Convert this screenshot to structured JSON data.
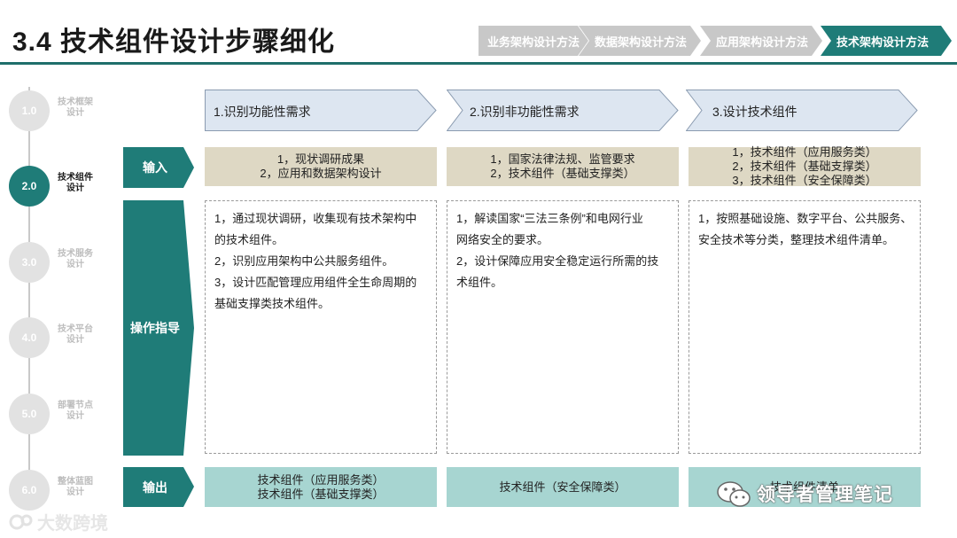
{
  "title": "3.4 技术组件设计步骤细化",
  "nav": [
    {
      "label": "业务架构设计方法",
      "active": false
    },
    {
      "label": "数据架构设计方法",
      "active": false
    },
    {
      "label": "应用架构设计方法",
      "active": false
    },
    {
      "label": "技术架构设计方法",
      "active": true
    }
  ],
  "timeline": [
    {
      "num": "1.0",
      "line1": "技术框架",
      "line2": "设计",
      "active": false
    },
    {
      "num": "2.0",
      "line1": "技术组件",
      "line2": "设计",
      "active": true
    },
    {
      "num": "3.0",
      "line1": "技术服务",
      "line2": "设计",
      "active": false
    },
    {
      "num": "4.0",
      "line1": "技术平台",
      "line2": "设计",
      "active": false
    },
    {
      "num": "5.0",
      "line1": "部署节点",
      "line2": "设计",
      "active": false
    },
    {
      "num": "6.0",
      "line1": "整体蓝图",
      "line2": "设计",
      "active": false
    }
  ],
  "rows": {
    "input": "输入",
    "guide": "操作指导",
    "output": "输出"
  },
  "steps": [
    {
      "header": "1.识别功能性需求",
      "input": [
        "1，现状调研成果",
        "2，应用和数据架构设计"
      ],
      "guide": [
        "1，通过现状调研，收集现有技术架构中",
        "的技术组件。",
        "2，识别应用架构中公共服务组件。",
        "3，设计匹配管理应用组件全生命周期的",
        "基础支撑类技术组件。"
      ],
      "output": [
        "技术组件（应用服务类）",
        "技术组件（基础支撑类）"
      ]
    },
    {
      "header": "2.识别非功能性需求",
      "input": [
        "1，国家法律法规、监管要求",
        "2，技术组件（基础支撑类）"
      ],
      "guide": [
        "1，解读国家“三法三条例”和电网行业",
        "网络安全的要求。",
        "2，设计保障应用安全稳定运行所需的技",
        "术组件。"
      ],
      "output": [
        "技术组件（安全保障类）"
      ]
    },
    {
      "header": "3.设计技术组件",
      "input": [
        "1，技术组件（应用服务类）",
        "2，技术组件（基础支撑类）",
        "3，技术组件（安全保障类）"
      ],
      "guide": [
        "1，按照基础设施、数字平台、公共服务、",
        "安全技术等分类，整理技术组件清单。"
      ],
      "output": [
        "技术组件清单"
      ]
    }
  ],
  "watermark_left": "大数跨境",
  "watermark_right": "领导者管理笔记",
  "colors": {
    "teal": "#1f7c78",
    "teal_rule": "#1f6f6b",
    "nav_inactive": "#c8c8c8",
    "nav_active": "#1f7c78",
    "input_bg": "#ded8c4",
    "output_bg": "#a7d5d1",
    "step_head_bg": "#dde6f1"
  }
}
